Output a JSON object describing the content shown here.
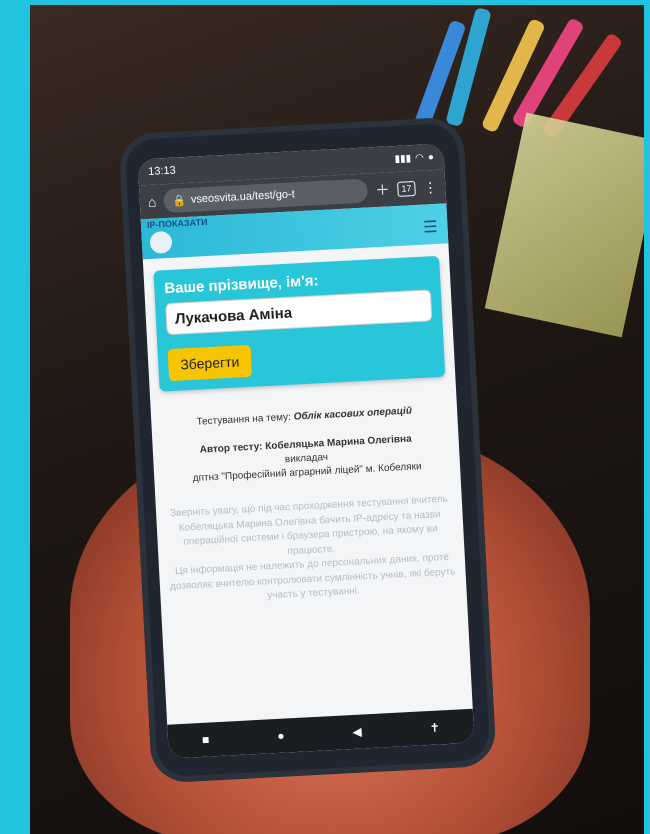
{
  "phone": {
    "status": {
      "time": "13:13",
      "battery": "●"
    },
    "browser": {
      "url": "vseosvita.ua/test/go-t",
      "tabs_count": "17"
    },
    "site": {
      "brand_label": "ІР-ПОКАЗАТИ",
      "menu_icon": "hamburger-icon"
    },
    "form": {
      "title": "Ваше прізвище, ім'я:",
      "name_value": "Лукачова Аміна",
      "save_label": "Зберегти"
    },
    "test_info": {
      "topic_prefix": "Тестування на тему:",
      "topic": "Облік касових операцій",
      "author_label": "Автор тесту:",
      "author": "Кобеляцька Марина Олегівна",
      "role": "викладач",
      "org": "дптнз \"Професійний аграрний ліцей\" м. Кобеляки"
    },
    "notice": {
      "p1": "Зверніть увагу, що під час проходження тестування вчитель Кобеляцька Марина Олегівна бачить IP-адресу та назви операційної системи і браузера пристрою, на якому ви працюєте.",
      "p2": "Ця інформація не належить до персональних даних, проте дозволяє вчителю контролювати сумлінність учнів, які беруть участь у тестуванні."
    }
  },
  "colors": {
    "frame": "#22c3de",
    "header": "#2bb8d6",
    "card": "#28c6d8",
    "button": "#f7c400"
  }
}
